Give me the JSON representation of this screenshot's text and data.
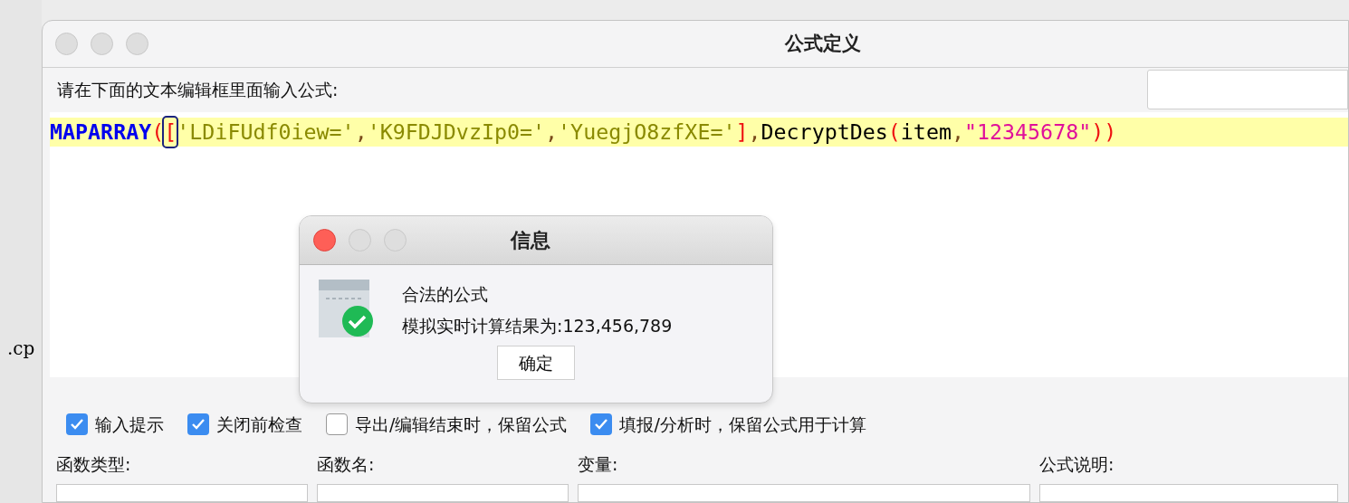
{
  "background": {
    "side_text": ".cp"
  },
  "window": {
    "title": "公式定义",
    "prompt": "请在下面的文本编辑框里面输入公式:",
    "formula": [
      {
        "text": "MAPARRAY",
        "kind": "keyword"
      },
      {
        "text": "(",
        "kind": "paren"
      },
      {
        "text": "[",
        "kind": "caret_paren"
      },
      {
        "text": "'LDiFUdf0iew='",
        "kind": "string"
      },
      {
        "text": ",",
        "kind": "punct"
      },
      {
        "text": "'K9FDJDvzIp0='",
        "kind": "string"
      },
      {
        "text": ",",
        "kind": "punct"
      },
      {
        "text": "'YuegjO8zfXE='",
        "kind": "string"
      },
      {
        "text": "]",
        "kind": "paren"
      },
      {
        "text": ",",
        "kind": "punct"
      },
      {
        "text": "DecryptDes",
        "kind": "name"
      },
      {
        "text": "(",
        "kind": "paren"
      },
      {
        "text": "item",
        "kind": "name"
      },
      {
        "text": ",",
        "kind": "punct"
      },
      {
        "text": "\"12345678\"",
        "kind": "number"
      },
      {
        "text": "))",
        "kind": "paren"
      }
    ],
    "options": [
      {
        "label": "输入提示",
        "checked": true
      },
      {
        "label": "关闭前检查",
        "checked": true
      },
      {
        "label": "导出/编辑结束时，保留公式",
        "checked": false
      },
      {
        "label": "填报/分析时，保留公式用于计算",
        "checked": true
      }
    ],
    "sections": [
      "函数类型:",
      "函数名:",
      "变量:",
      "公式说明:"
    ]
  },
  "dialog": {
    "title": "信息",
    "lines": [
      "合法的公式",
      "模拟实时计算结果为:123,456,789"
    ],
    "button": "确定"
  }
}
